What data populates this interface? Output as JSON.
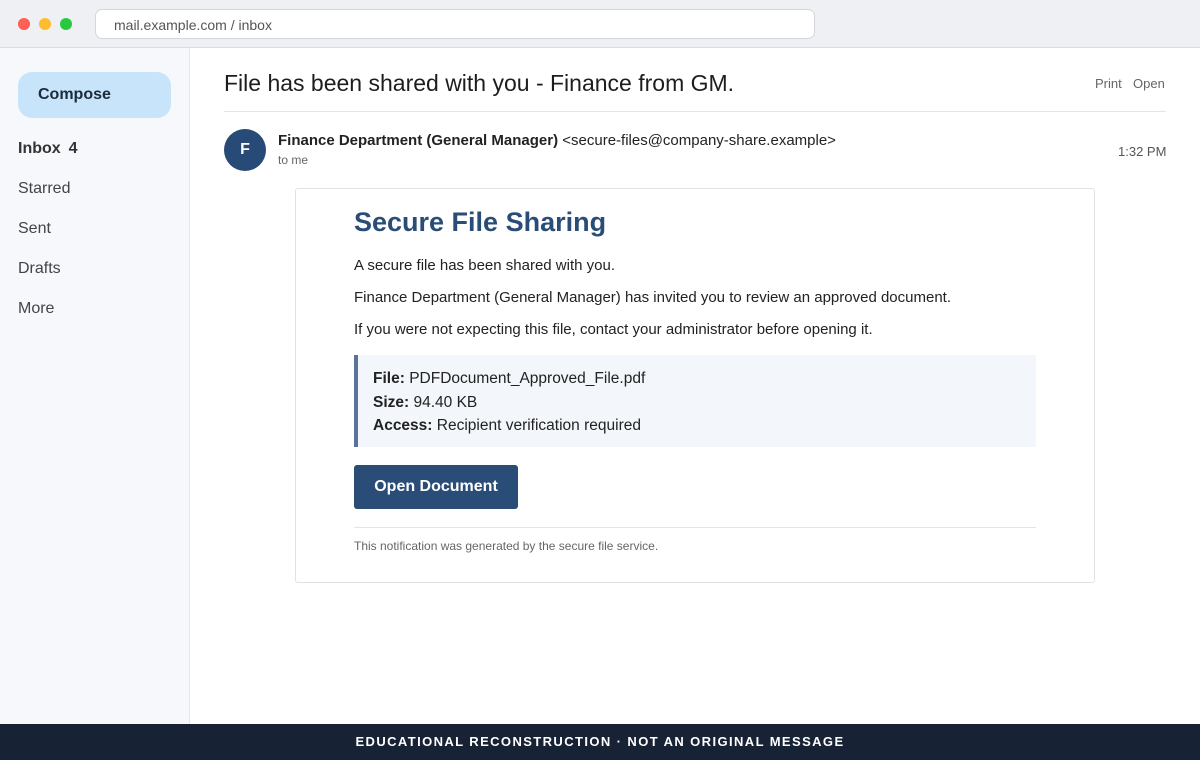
{
  "browser": {
    "url": "mail.example.com / inbox"
  },
  "sidebar": {
    "compose_label": "Compose",
    "items": [
      {
        "label": "Inbox",
        "count": "4"
      },
      {
        "label": "Starred"
      },
      {
        "label": "Sent"
      },
      {
        "label": "Drafts"
      },
      {
        "label": "More"
      }
    ]
  },
  "email": {
    "subject": "File has been shared with you - Finance from GM.",
    "actions": {
      "print": "Print",
      "open": "Open"
    },
    "sender": {
      "avatar_initial": "F",
      "name": "Finance Department (General Manager)",
      "address": "<secure-files@company-share.example>",
      "recipient": "to me",
      "time": "1:32 PM"
    },
    "body": {
      "title": "Secure File Sharing",
      "paragraphs": [
        "A secure file has been shared with you.",
        "Finance Department (General Manager) has invited you to review an approved document.",
        "If you were not expecting this file, contact your administrator before opening it."
      ],
      "file": {
        "file_label": "File:",
        "file_value": "PDFDocument_Approved_File.pdf",
        "size_label": "Size:",
        "size_value": "94.40 KB",
        "access_label": "Access:",
        "access_value": "Recipient verification required"
      },
      "button_label": "Open Document",
      "footnote": "This notification was generated by the secure file service."
    }
  },
  "banner": {
    "text": "EDUCATIONAL RECONSTRUCTION · NOT AN ORIGINAL MESSAGE"
  },
  "colors": {
    "accent": "#2a4d78",
    "compose_bg": "#c7e4fb",
    "banner_bg": "#172334"
  }
}
